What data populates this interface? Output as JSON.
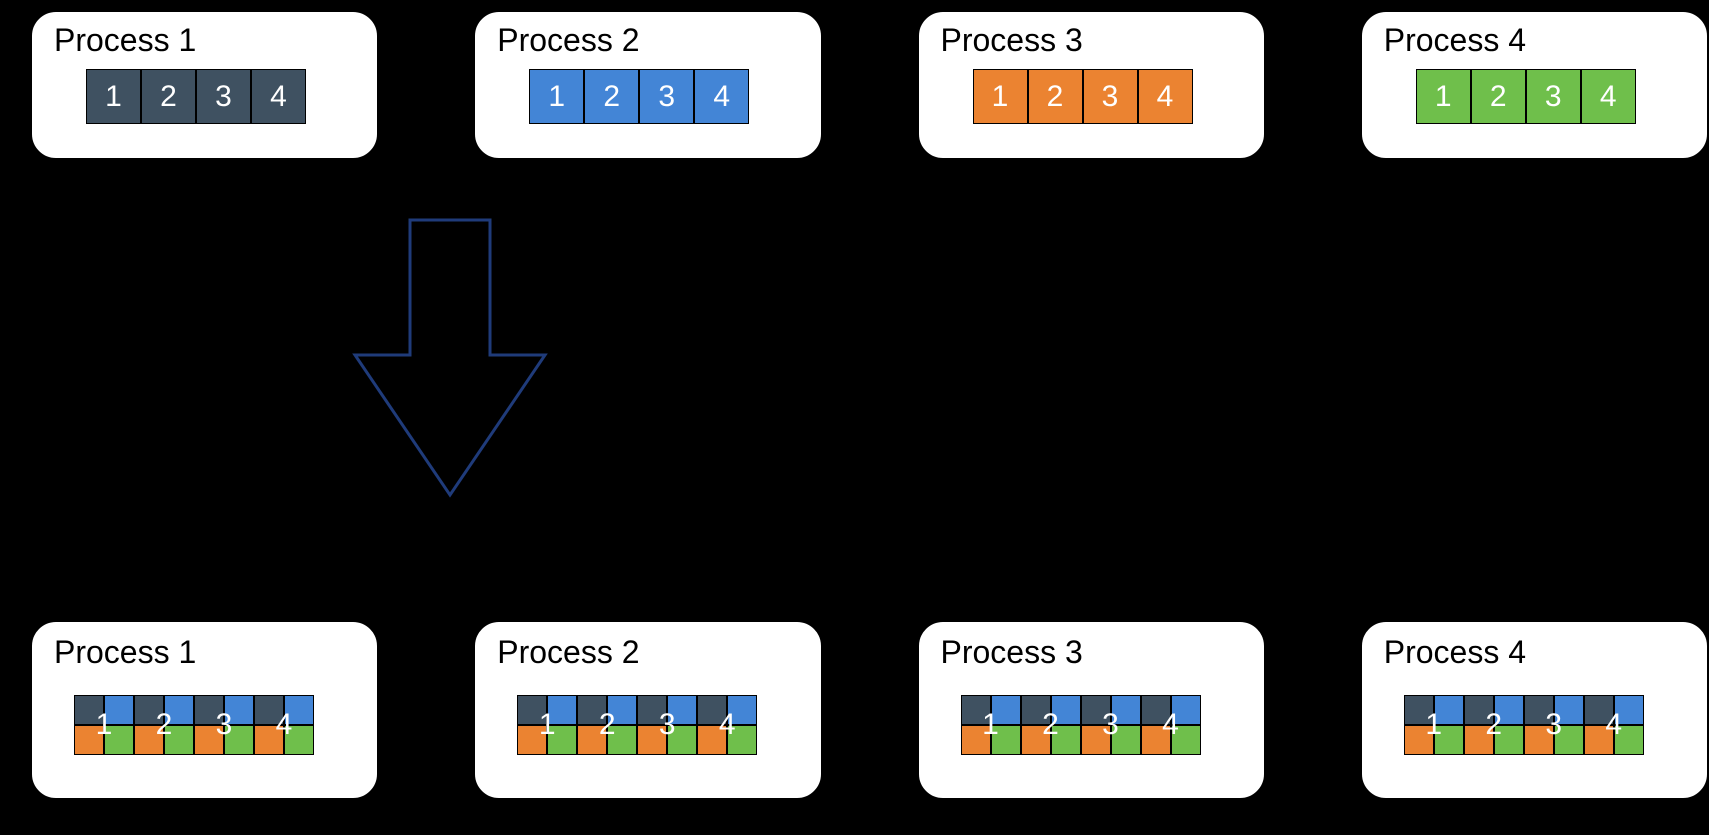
{
  "colors": {
    "dark": "#3f5161",
    "blue": "#4385d6",
    "orange": "#eb8331",
    "green": "#6fbf4b",
    "arrowStroke": "#1f3b7a"
  },
  "cellNumbers": [
    "1",
    "2",
    "3",
    "4"
  ],
  "top": {
    "processes": [
      {
        "label": "Process 1",
        "color": "dark"
      },
      {
        "label": "Process 2",
        "color": "blue"
      },
      {
        "label": "Process 3",
        "color": "orange"
      },
      {
        "label": "Process 4",
        "color": "green"
      }
    ]
  },
  "bottom": {
    "processes": [
      {
        "label": "Process 1"
      },
      {
        "label": "Process 2"
      },
      {
        "label": "Process 3"
      },
      {
        "label": "Process 4"
      }
    ],
    "quadColors": [
      "dark",
      "blue",
      "orange",
      "green"
    ]
  }
}
